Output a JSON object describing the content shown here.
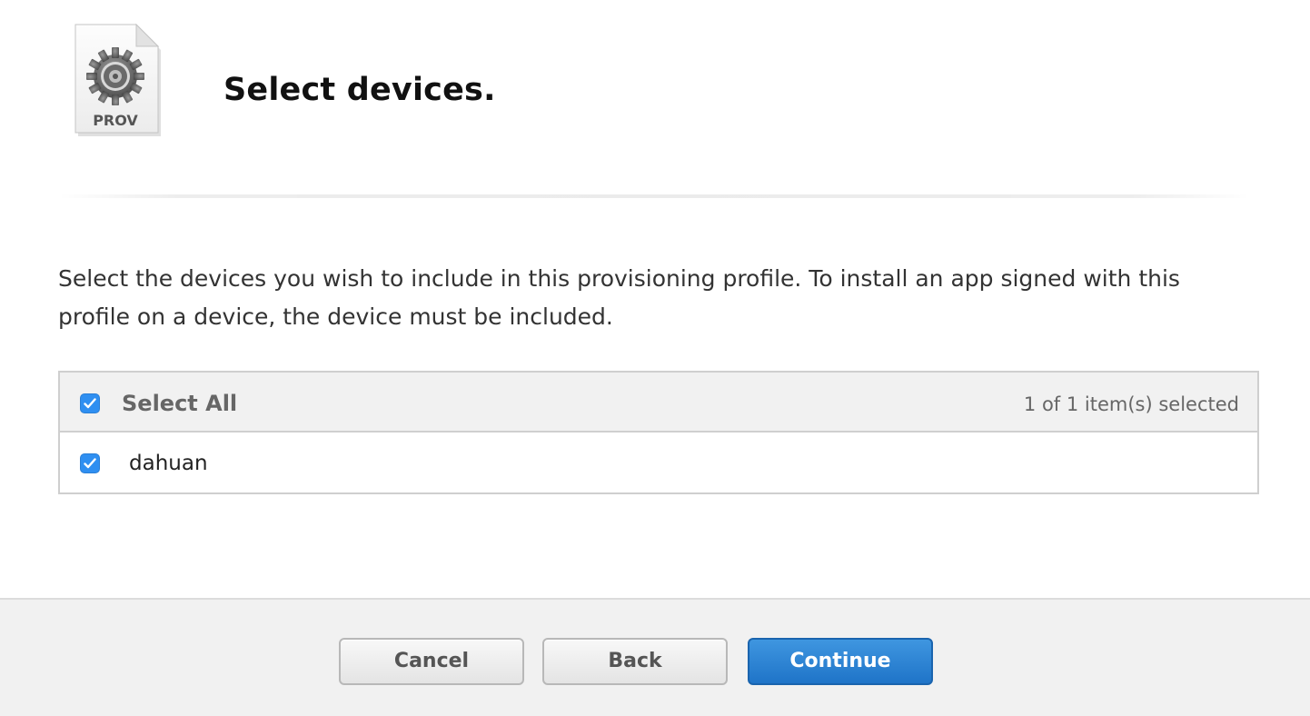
{
  "header": {
    "icon": "prov-file-gear-icon",
    "icon_label": "PROV",
    "title": "Select devices."
  },
  "description": "Select the devices you wish to include in this provisioning profile. To install an app signed with this profile on a device, the device must be included.",
  "device_table": {
    "select_all": {
      "label": "Select All",
      "checked": true
    },
    "selection_count": "1 of 1 item(s) selected",
    "rows": [
      {
        "name": "dahuan",
        "checked": true
      }
    ]
  },
  "footer": {
    "cancel_label": "Cancel",
    "back_label": "Back",
    "continue_label": "Continue"
  },
  "colors": {
    "accent": "#2f8ff1",
    "primary_button": "#2a82d4",
    "table_header_bg": "#f1f1f1",
    "footer_bg": "#f1f1f1"
  }
}
